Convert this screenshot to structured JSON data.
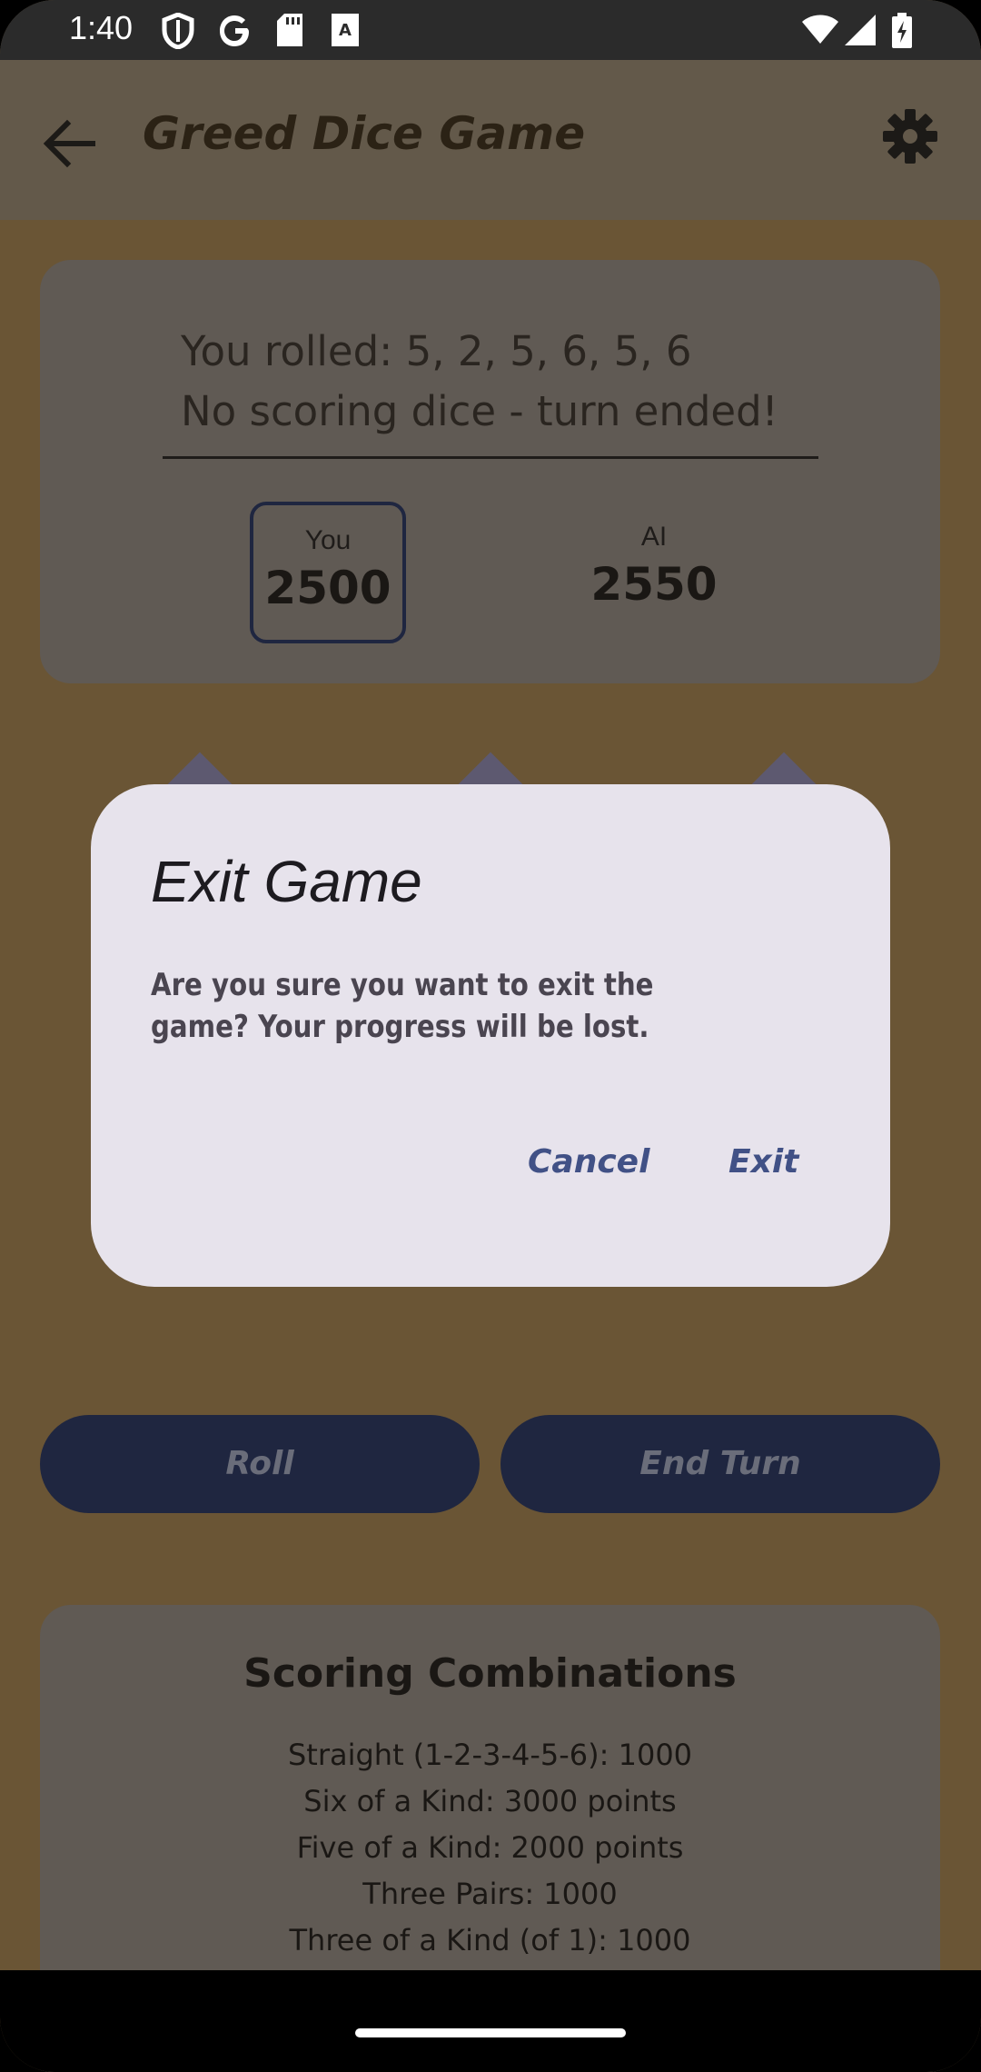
{
  "status_bar": {
    "time": "1:40",
    "icons": [
      "shield-icon",
      "google-icon",
      "sd-card-icon",
      "font-icon",
      "wifi-icon",
      "signal-icon",
      "battery-charging-icon"
    ]
  },
  "app_bar": {
    "title": "Greed Dice Game",
    "back_icon": "arrow-back-icon",
    "settings_icon": "gear-icon"
  },
  "status_card": {
    "roll_message": "You rolled: 5, 2, 5, 6, 5, 6\nNo scoring dice - turn ended!",
    "players": [
      {
        "name": "You",
        "score": "2500",
        "active": true
      },
      {
        "name": "AI",
        "score": "2550",
        "active": false
      }
    ]
  },
  "actions": {
    "roll_label": "Roll",
    "end_turn_label": "End Turn"
  },
  "scoring": {
    "title": "Scoring Combinations",
    "rules": [
      "Straight (1-2-3-4-5-6): 1000",
      "Six of a Kind: 3000 points",
      "Five of a Kind: 2000 points",
      "Three Pairs: 1000",
      "Three of a Kind (of 1): 1000"
    ]
  },
  "dialog": {
    "title": "Exit Game",
    "message": "Are you sure you want to exit the game? Your progress will be lost.",
    "cancel_label": "Cancel",
    "exit_label": "Exit"
  },
  "colors": {
    "background": "#6a5535",
    "app_bar": "#63594a",
    "card": "#605a54",
    "button": "#1f2640",
    "dialog": "#e7e3ec",
    "dialog_accent": "#415186"
  }
}
